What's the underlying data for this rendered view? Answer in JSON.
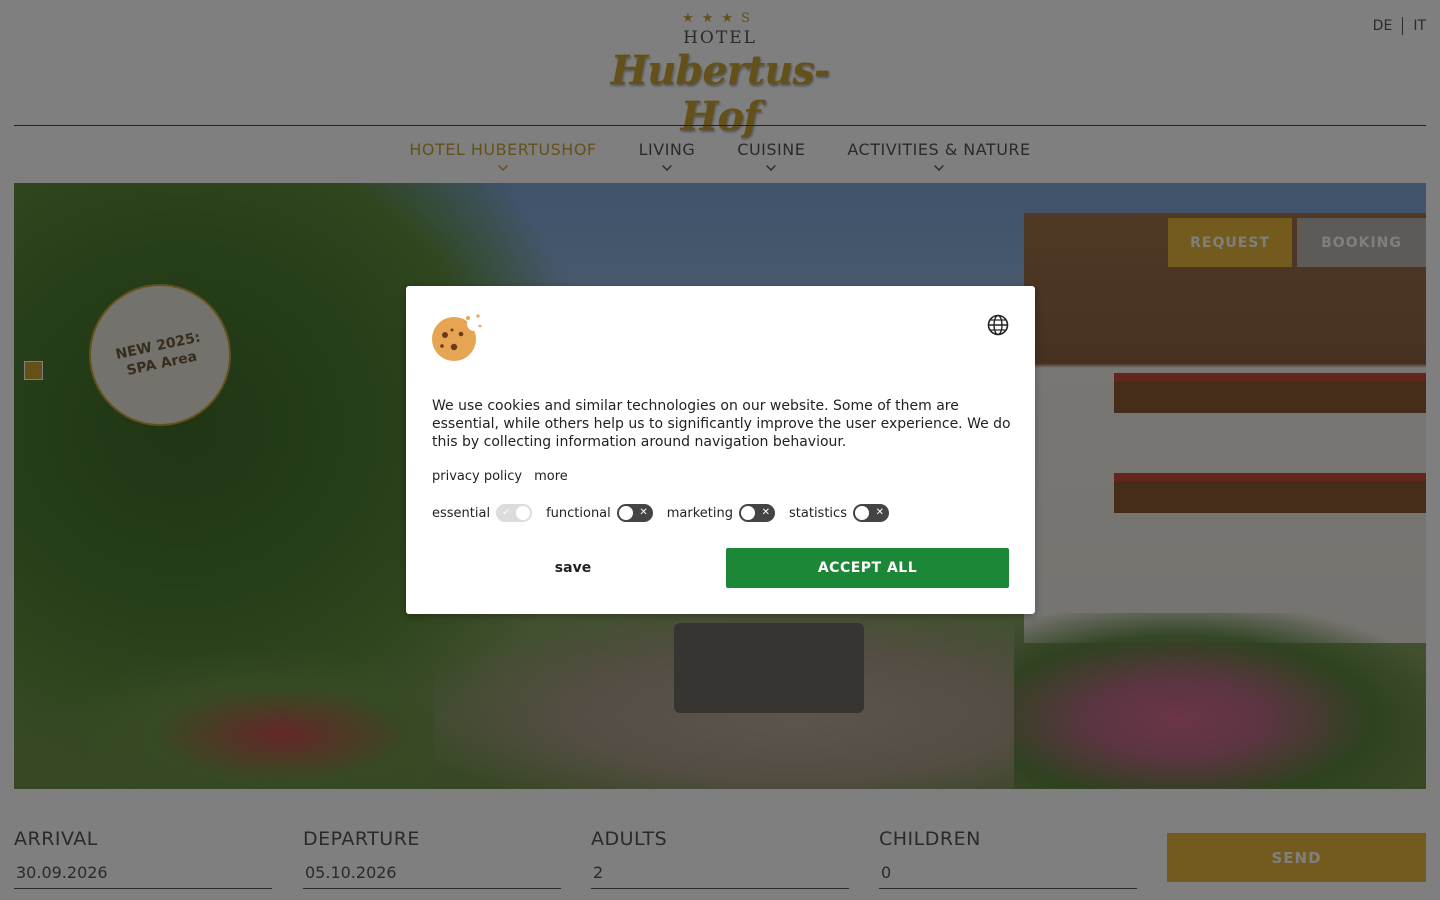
{
  "header": {
    "logo": {
      "stars": "★★★S",
      "hotel": "HOTEL",
      "name": "Hubertus-Hof"
    },
    "languages": [
      "DE",
      "IT"
    ]
  },
  "nav": {
    "items": [
      {
        "label": "HOTEL HUBERTUSHOF",
        "active": true
      },
      {
        "label": "LIVING",
        "active": false
      },
      {
        "label": "CUISINE",
        "active": false
      },
      {
        "label": "ACTIVITIES & NATURE",
        "active": false
      }
    ]
  },
  "hero": {
    "badge_line1": "NEW 2025:",
    "badge_line2": "SPA Area",
    "request_label": "REQUEST",
    "booking_label": "BOOKING"
  },
  "form": {
    "arrival": {
      "label": "ARRIVAL",
      "value": "30.09.2026"
    },
    "departure": {
      "label": "DEPARTURE",
      "value": "05.10.2026"
    },
    "adults": {
      "label": "ADULTS",
      "value": "2"
    },
    "children": {
      "label": "CHILDREN",
      "value": "0"
    },
    "send_label": "SEND"
  },
  "cookie_dialog": {
    "message": "We use cookies and similar technologies on our website. Some of them are essential, while others help us to significantly improve the user experience. We do this by collecting information around navigation behaviour.",
    "privacy_link": "privacy policy",
    "more_link": "more",
    "toggles": [
      {
        "label": "essential",
        "state": "on-disabled"
      },
      {
        "label": "functional",
        "state": "off"
      },
      {
        "label": "marketing",
        "state": "off"
      },
      {
        "label": "statistics",
        "state": "off"
      }
    ],
    "save_label": "save",
    "accept_label": "ACCEPT ALL"
  },
  "colors": {
    "accent": "#c9a233",
    "accept_green": "#1d8738",
    "overlay": "rgba(0,0,0,0.5)"
  }
}
